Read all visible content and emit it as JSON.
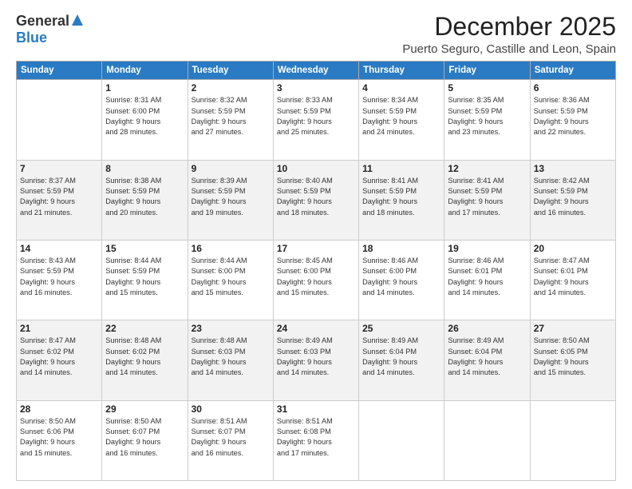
{
  "header": {
    "logo_general": "General",
    "logo_blue": "Blue",
    "month_title": "December 2025",
    "location": "Puerto Seguro, Castille and Leon, Spain"
  },
  "days_of_week": [
    "Sunday",
    "Monday",
    "Tuesday",
    "Wednesday",
    "Thursday",
    "Friday",
    "Saturday"
  ],
  "weeks": [
    [
      {
        "day": "",
        "info": ""
      },
      {
        "day": "1",
        "info": "Sunrise: 8:31 AM\nSunset: 6:00 PM\nDaylight: 9 hours\nand 28 minutes."
      },
      {
        "day": "2",
        "info": "Sunrise: 8:32 AM\nSunset: 5:59 PM\nDaylight: 9 hours\nand 27 minutes."
      },
      {
        "day": "3",
        "info": "Sunrise: 8:33 AM\nSunset: 5:59 PM\nDaylight: 9 hours\nand 25 minutes."
      },
      {
        "day": "4",
        "info": "Sunrise: 8:34 AM\nSunset: 5:59 PM\nDaylight: 9 hours\nand 24 minutes."
      },
      {
        "day": "5",
        "info": "Sunrise: 8:35 AM\nSunset: 5:59 PM\nDaylight: 9 hours\nand 23 minutes."
      },
      {
        "day": "6",
        "info": "Sunrise: 8:36 AM\nSunset: 5:59 PM\nDaylight: 9 hours\nand 22 minutes."
      }
    ],
    [
      {
        "day": "7",
        "info": "Sunrise: 8:37 AM\nSunset: 5:59 PM\nDaylight: 9 hours\nand 21 minutes."
      },
      {
        "day": "8",
        "info": "Sunrise: 8:38 AM\nSunset: 5:59 PM\nDaylight: 9 hours\nand 20 minutes."
      },
      {
        "day": "9",
        "info": "Sunrise: 8:39 AM\nSunset: 5:59 PM\nDaylight: 9 hours\nand 19 minutes."
      },
      {
        "day": "10",
        "info": "Sunrise: 8:40 AM\nSunset: 5:59 PM\nDaylight: 9 hours\nand 18 minutes."
      },
      {
        "day": "11",
        "info": "Sunrise: 8:41 AM\nSunset: 5:59 PM\nDaylight: 9 hours\nand 18 minutes."
      },
      {
        "day": "12",
        "info": "Sunrise: 8:41 AM\nSunset: 5:59 PM\nDaylight: 9 hours\nand 17 minutes."
      },
      {
        "day": "13",
        "info": "Sunrise: 8:42 AM\nSunset: 5:59 PM\nDaylight: 9 hours\nand 16 minutes."
      }
    ],
    [
      {
        "day": "14",
        "info": "Sunrise: 8:43 AM\nSunset: 5:59 PM\nDaylight: 9 hours\nand 16 minutes."
      },
      {
        "day": "15",
        "info": "Sunrise: 8:44 AM\nSunset: 5:59 PM\nDaylight: 9 hours\nand 15 minutes."
      },
      {
        "day": "16",
        "info": "Sunrise: 8:44 AM\nSunset: 6:00 PM\nDaylight: 9 hours\nand 15 minutes."
      },
      {
        "day": "17",
        "info": "Sunrise: 8:45 AM\nSunset: 6:00 PM\nDaylight: 9 hours\nand 15 minutes."
      },
      {
        "day": "18",
        "info": "Sunrise: 8:46 AM\nSunset: 6:00 PM\nDaylight: 9 hours\nand 14 minutes."
      },
      {
        "day": "19",
        "info": "Sunrise: 8:46 AM\nSunset: 6:01 PM\nDaylight: 9 hours\nand 14 minutes."
      },
      {
        "day": "20",
        "info": "Sunrise: 8:47 AM\nSunset: 6:01 PM\nDaylight: 9 hours\nand 14 minutes."
      }
    ],
    [
      {
        "day": "21",
        "info": "Sunrise: 8:47 AM\nSunset: 6:02 PM\nDaylight: 9 hours\nand 14 minutes."
      },
      {
        "day": "22",
        "info": "Sunrise: 8:48 AM\nSunset: 6:02 PM\nDaylight: 9 hours\nand 14 minutes."
      },
      {
        "day": "23",
        "info": "Sunrise: 8:48 AM\nSunset: 6:03 PM\nDaylight: 9 hours\nand 14 minutes."
      },
      {
        "day": "24",
        "info": "Sunrise: 8:49 AM\nSunset: 6:03 PM\nDaylight: 9 hours\nand 14 minutes."
      },
      {
        "day": "25",
        "info": "Sunrise: 8:49 AM\nSunset: 6:04 PM\nDaylight: 9 hours\nand 14 minutes."
      },
      {
        "day": "26",
        "info": "Sunrise: 8:49 AM\nSunset: 6:04 PM\nDaylight: 9 hours\nand 14 minutes."
      },
      {
        "day": "27",
        "info": "Sunrise: 8:50 AM\nSunset: 6:05 PM\nDaylight: 9 hours\nand 15 minutes."
      }
    ],
    [
      {
        "day": "28",
        "info": "Sunrise: 8:50 AM\nSunset: 6:06 PM\nDaylight: 9 hours\nand 15 minutes."
      },
      {
        "day": "29",
        "info": "Sunrise: 8:50 AM\nSunset: 6:07 PM\nDaylight: 9 hours\nand 16 minutes."
      },
      {
        "day": "30",
        "info": "Sunrise: 8:51 AM\nSunset: 6:07 PM\nDaylight: 9 hours\nand 16 minutes."
      },
      {
        "day": "31",
        "info": "Sunrise: 8:51 AM\nSunset: 6:08 PM\nDaylight: 9 hours\nand 17 minutes."
      },
      {
        "day": "",
        "info": ""
      },
      {
        "day": "",
        "info": ""
      },
      {
        "day": "",
        "info": ""
      }
    ]
  ]
}
